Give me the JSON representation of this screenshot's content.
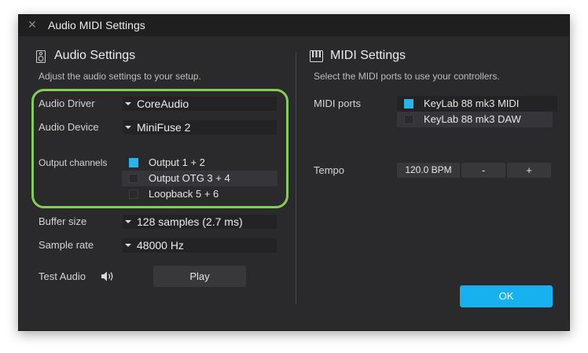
{
  "window": {
    "title": "Audio MIDI Settings"
  },
  "audio": {
    "title": "Audio Settings",
    "description": "Adjust the audio settings to your setup.",
    "driver_label": "Audio Driver",
    "driver_value": "CoreAudio",
    "device_label": "Audio Device",
    "device_value": "MiniFuse 2",
    "output_label": "Output channels",
    "outputs": [
      {
        "label": "Output 1 + 2",
        "checked": true
      },
      {
        "label": "Output OTG 3 + 4",
        "checked": false
      },
      {
        "label": "Loopback 5 + 6",
        "checked": false
      }
    ],
    "buffer_label": "Buffer size",
    "buffer_value": "128 samples (2.7 ms)",
    "rate_label": "Sample rate",
    "rate_value": "48000 Hz",
    "test_label": "Test Audio",
    "play_label": "Play"
  },
  "midi": {
    "title": "MIDI Settings",
    "description": "Select the MIDI ports to use your controllers.",
    "ports_label": "MIDI ports",
    "ports": [
      {
        "label": "KeyLab 88 mk3 MIDI",
        "checked": true
      },
      {
        "label": "KeyLab 88 mk3 DAW",
        "checked": false
      }
    ],
    "tempo_label": "Tempo",
    "tempo_value": "120.0 BPM",
    "tempo_minus": "-",
    "tempo_plus": "+"
  },
  "ok_label": "OK",
  "colors": {
    "accent": "#16b1ee",
    "highlight_ring": "#86cc55",
    "background": "#2a2a2c"
  },
  "icons": {
    "close": "close-icon",
    "speaker": "speaker-icon",
    "piano": "piano-keys-icon",
    "volume": "volume-icon"
  }
}
